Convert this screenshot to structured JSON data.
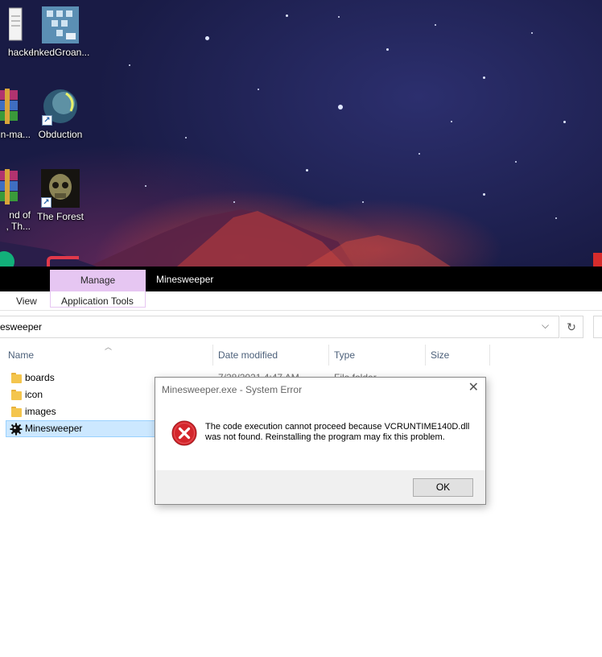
{
  "desktop": {
    "icons": [
      {
        "label": "hacker"
      },
      {
        "label": "InkedGroan..."
      },
      {
        "label": "n-ma..."
      },
      {
        "label": "Obduction"
      },
      {
        "label": "nd of"
      },
      {
        "label": ", Th..."
      },
      {
        "label": "The Forest"
      }
    ]
  },
  "explorer": {
    "contextual_tab": "Manage",
    "window_title": "Minesweeper",
    "ribbon": {
      "view_tab": "View",
      "application_tools_tab": "Application Tools"
    },
    "address": {
      "path_text": "esweeper",
      "refresh_glyph": "↻",
      "dropdown_glyph": "⌵"
    },
    "columns": {
      "name": "Name",
      "date_modified": "Date modified",
      "type": "Type",
      "size": "Size"
    },
    "rows": [
      {
        "name": "boards",
        "date_modified": "7/28/2021 4:47 AM",
        "type": "File folder",
        "icon": "folder-icon"
      },
      {
        "name": "icon",
        "icon": "folder-icon"
      },
      {
        "name": "images",
        "icon": "folder-icon"
      },
      {
        "name": "Minesweeper",
        "icon": "application-icon",
        "selected": true
      }
    ]
  },
  "dialog": {
    "title": "Minesweeper.exe - System Error",
    "close_glyph": "✕",
    "message": "The code execution cannot proceed because VCRUNTIME140D.dll was not found. Reinstalling the program may fix this problem.",
    "ok_label": "OK",
    "icon": "error-icon"
  },
  "colors": {
    "manage_tab": "#e6c6f2",
    "selection": "#cce8ff",
    "error_red": "#d4262c"
  }
}
